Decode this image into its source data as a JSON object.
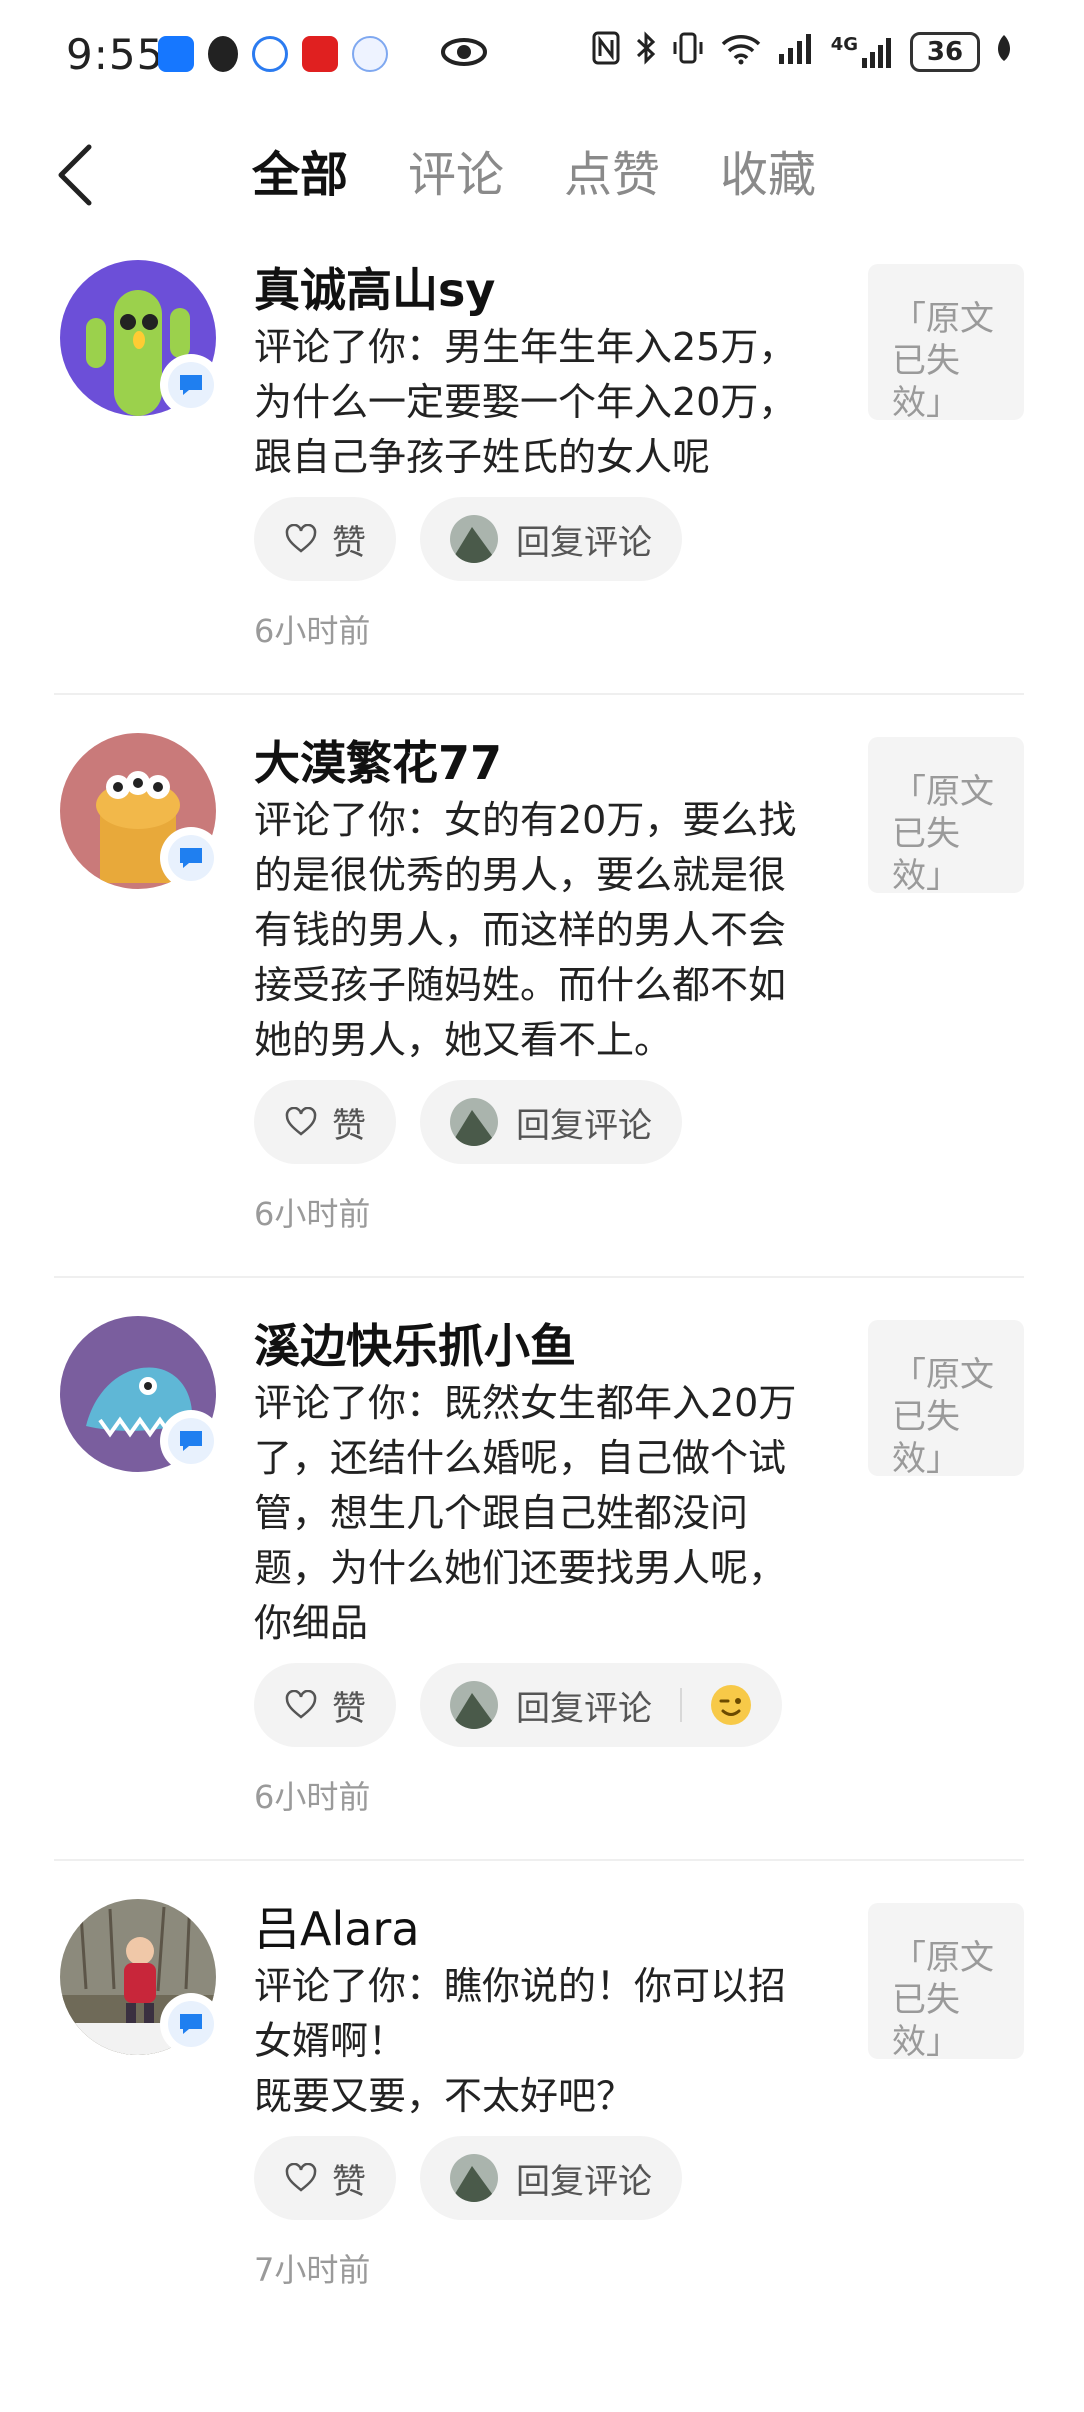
{
  "status_bar": {
    "time": "9:55",
    "network": "4G",
    "battery": "36"
  },
  "header": {
    "tabs": [
      {
        "label": "全部",
        "active": true
      },
      {
        "label": "评论",
        "active": false
      },
      {
        "label": "点赞",
        "active": false
      },
      {
        "label": "收藏",
        "active": false
      }
    ]
  },
  "labels": {
    "like": "赞",
    "reply": "回复评论",
    "original_expired": "「原文已失效」"
  },
  "items": [
    {
      "username": "真诚高山sy",
      "comment": "评论了你：男生年生年入25万，为什么一定要娶一个年入20万，跟自己争孩子姓氏的女人呢",
      "time": "6小时前"
    },
    {
      "username": "大漠繁花77",
      "comment": "评论了你：女的有20万，要么找的是很优秀的男人，要么就是很有钱的男人，而这样的男人不会接受孩子随妈姓。而什么都不如她的男人，她又看不上。",
      "time": "6小时前"
    },
    {
      "username": "溪边快乐抓小鱼",
      "comment": "评论了你：既然女生都年入20万了，还结什么婚呢，自己做个试管，想生几个跟自己姓都没问题，为什么她们还要找男人呢，你细品",
      "time": "6小时前"
    },
    {
      "username": "吕Alara",
      "comment": "评论了你：瞧你说的！你可以招女婿啊！\n既要又要，不太好吧？",
      "time": "7小时前"
    }
  ],
  "colors": {
    "accent_blue": "#1f7ff0",
    "muted_text": "#9a9a9a"
  }
}
